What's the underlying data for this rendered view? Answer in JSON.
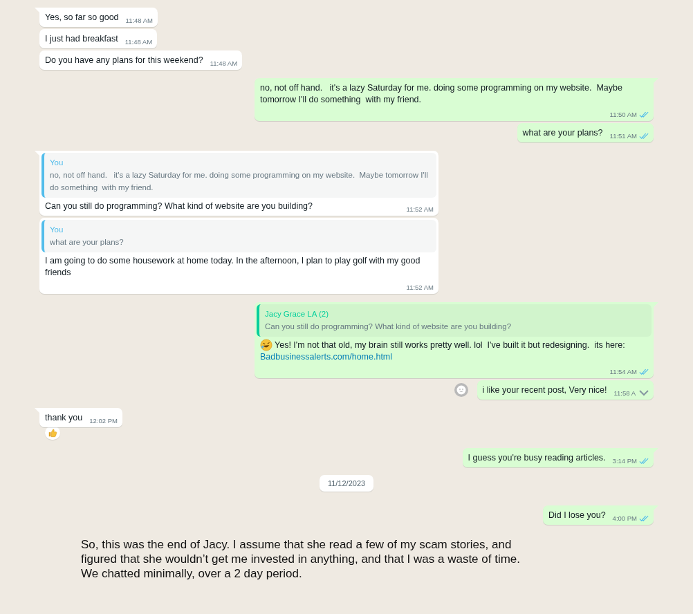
{
  "messages": [
    {
      "kind": "text",
      "outgoing": false,
      "tail": true,
      "text": "Yes, so far so good",
      "time": "11:48 AM"
    },
    {
      "kind": "text",
      "outgoing": false,
      "tail": false,
      "text": "I just had breakfast",
      "time": "11:48 AM"
    },
    {
      "kind": "text",
      "outgoing": false,
      "tail": false,
      "text": "Do you have any plans for this weekend?",
      "time": "11:48 AM"
    },
    {
      "kind": "text",
      "outgoing": true,
      "tail": true,
      "text": "no, not off hand.   it's a lazy Saturday for me. doing some programming on my website.  Maybe tomorrow I'll do something  with my friend.",
      "time": "11:50 AM",
      "read": true
    },
    {
      "kind": "text",
      "outgoing": true,
      "tail": false,
      "text": "what are your plans?",
      "time": "11:51 AM",
      "read": true
    },
    {
      "kind": "quote",
      "outgoing": false,
      "tail": true,
      "quote_author": "You",
      "quote_text": "no, not off hand.   it's a lazy Saturday for me. doing some programming on my website.  Maybe tomorrow I'll do something  with my friend.",
      "text": "Can you still do programming? What kind of website are you building?",
      "time": "11:52 AM"
    },
    {
      "kind": "quote",
      "outgoing": false,
      "tail": false,
      "quote_author": "You",
      "quote_text": "what are your plans?",
      "text": "I am going to do some housework at home today. In the afternoon, I plan to play golf with my good friends",
      "time": "11:52 AM"
    },
    {
      "kind": "quote",
      "outgoing": true,
      "tail": true,
      "quote_author": "Jacy Grace LA (2)",
      "quote_text": "Can you still do programming? What kind of website are you building?",
      "has_emoji": true,
      "text": "Yes! I'm not that old, my brain still works pretty well. lol  I've built it but redesigning.  its here:",
      "link": "Badbusinessalerts.com/home.html",
      "time": "11:54 AM",
      "read": true
    },
    {
      "kind": "text",
      "outgoing": true,
      "tail": false,
      "react_button": true,
      "menu_chevron": true,
      "text": "i like your recent post, Very nice!",
      "time": "11:58 A"
    },
    {
      "kind": "text",
      "outgoing": false,
      "tail": true,
      "reaction": true,
      "text": "thank you",
      "time": "12:02 PM"
    },
    {
      "kind": "text",
      "outgoing": true,
      "tail": true,
      "text": "I guess you're busy reading articles.",
      "time": "3:14 PM",
      "read": true
    },
    {
      "kind": "date",
      "text": "11/12/2023"
    },
    {
      "kind": "text",
      "outgoing": true,
      "tail": true,
      "text": "Did I lose you?",
      "time": "4:00 PM",
      "read": true
    }
  ],
  "annotation": "So, this was the end of Jacy. I assume that she read a few of my scam stories, and figured that she wouldn’t get me invested in anything, and that I was a waste of time.  We chatted minimally, over a 2 day period."
}
